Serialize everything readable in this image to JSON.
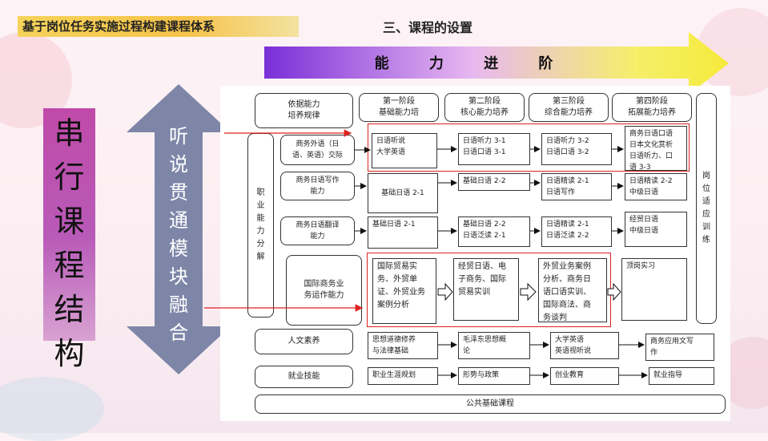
{
  "slide_title": "基于岗位任务实施过程构建课程体系",
  "section_title": "三、课程的设置",
  "progress_arrow_label": "能 力 进 阶",
  "left_label_chars": [
    "串",
    "行",
    "课",
    "程",
    "结",
    "构"
  ],
  "double_arrow_chars": [
    "听",
    "说",
    "贯",
    "通",
    "模",
    "块",
    "融",
    "合"
  ],
  "header": {
    "basis": "依据能力\n培养规律",
    "stage1": "第一阶段\n基础能力培",
    "stage2": "第二阶段\n核心能力培养",
    "stage3": "第三阶段\n综合能力培养",
    "stage4": "第四阶段\n拓展能力培养"
  },
  "side_left_label": "职\n业\n能\n力\n分\n解",
  "side_right_label": "岗\n位\n适\n应\n训\n练",
  "rows": [
    {
      "ability": "商务外语（日\n语、英语）交际",
      "s1": "日语听说\n大学英语",
      "s2": "日语听力 3-1\n日语口语 3-1",
      "s3": "日语听力 3-2\n日语口语 3-2",
      "s4": "商务日语口语\n日本文化赏析\n日语听力、口\n语 3-3"
    },
    {
      "ability": "商务日语写作\n能力",
      "s1": "基础日语 2-1",
      "s2": "基础日语 2-2",
      "s3": "日语精读 2-1\n日语写作",
      "s4": "日语精读 2-2\n中级日语"
    },
    {
      "ability": "商务日语翻译\n能力",
      "s1": "基础日语 2-1",
      "s2": "基础日语 2-2\n日语泛读 2-1",
      "s3": "日语精读 2-1\n日语泛读 2-2",
      "s4": "经贸日语\n中级日语"
    },
    {
      "ability": "国际商务业\n务运作能力",
      "s1": "国际贸易实\n务、外贸单\n证、外贸业务\n案例分析",
      "s2": "经贸日语、电\n子商务、国际\n贸易实训",
      "s3": "外贸业务案例\n分析、商务日\n语口语实训、\n国际商法、商\n务谈判",
      "s4": "顶岗实习"
    }
  ],
  "humanities": {
    "label": "人文素养",
    "c1": "思想道德修养\n与法律基础",
    "c2": "毛泽东思想概\n论",
    "c3": "大学英语\n英语视听说",
    "c4": "商务应用文写\n作"
  },
  "employment": {
    "label": "就业技能",
    "c1": "职业生涯规划",
    "c2": "形势与政策",
    "c3": "创业教育",
    "c4": "就业指导"
  },
  "footer_label": "公共基础课程",
  "colors": {
    "title_bar": "#f5d35a",
    "arrow_gradient_start": "#7a2fd8",
    "arrow_gradient_end": "#f5ea3a",
    "left_label": "#c04aa8",
    "double_arrow": "#7e86a8",
    "red_highlight": "#dd2222"
  }
}
